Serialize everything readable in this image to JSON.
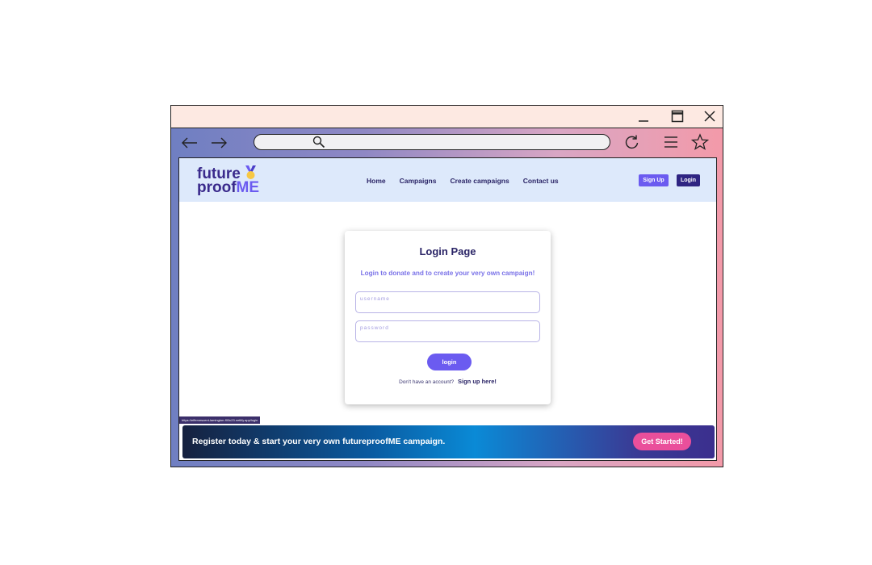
{
  "browser": {
    "icons": {
      "minimize": "minimize-icon",
      "maximize": "maximize-icon",
      "close": "close-icon",
      "back": "arrow-left-icon",
      "forward": "arrow-right-icon",
      "search": "search-icon",
      "reload": "reload-icon",
      "menu": "hamburger-menu-icon",
      "bookmark": "star-icon"
    }
  },
  "site": {
    "logo": {
      "line1": "future",
      "line2_a": "proof",
      "line2_b": "ME",
      "badge_icon": "medal-icon"
    },
    "nav": [
      "Home",
      "Campaigns",
      "Create campaigns",
      "Contact us"
    ],
    "signup_label": "Sign Up",
    "login_label": "Login"
  },
  "login_card": {
    "title": "Login Page",
    "subtitle": "Login to donate and to create your very own campaign!",
    "username_placeholder": "username",
    "password_placeholder": "password",
    "submit_label": "login",
    "no_account_text": "Don't have an account?",
    "signup_link": "Sign up here!"
  },
  "status_url": "https://effervescent-lamington-f00c23.netlify.app/login",
  "banner": {
    "text": "Register today & start your very own futureproofME campaign.",
    "button_label": "Get Started!"
  },
  "colors": {
    "brand_primary": "#6b5bf0",
    "brand_dark": "#2f2482",
    "cta_pink": "#ea4f9b",
    "header_bg": "#dde9fb"
  }
}
